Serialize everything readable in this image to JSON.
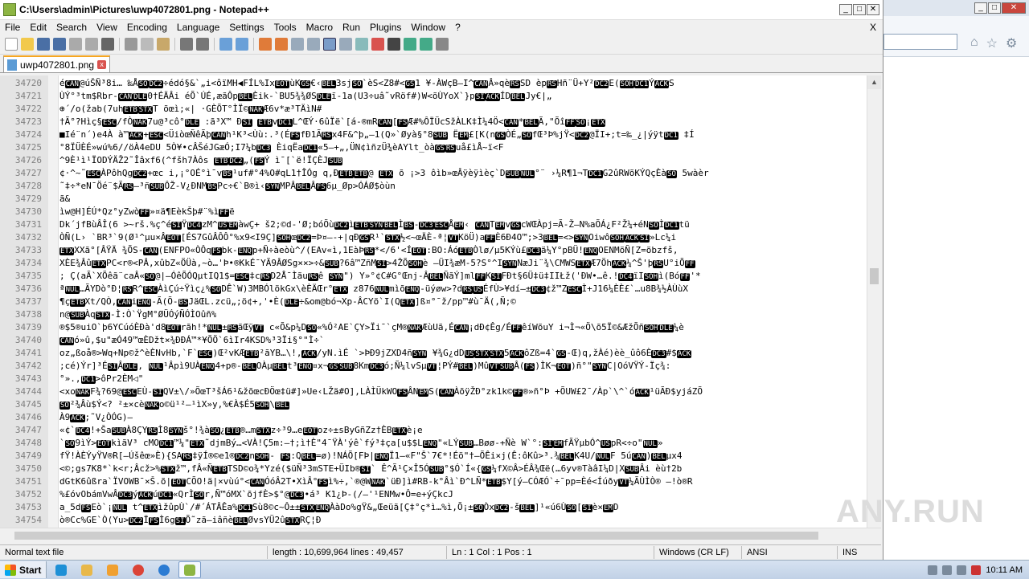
{
  "window": {
    "title": "C:\\Users\\admin\\Pictures\\uwp4072801.png - Notepad++",
    "menus": [
      "File",
      "Edit",
      "Search",
      "View",
      "Encoding",
      "Language",
      "Settings",
      "Tools",
      "Macro",
      "Run",
      "Plugins",
      "Window",
      "?"
    ],
    "close_x": "X"
  },
  "tab": {
    "label": "uwp4072801.png"
  },
  "editor": {
    "lines": [
      {
        "n": "34720",
        "t": "éCAN@úŠÑ³8i… ‰ÅSODC2÷édó§&`„i<ôïMH◀FÍL%IxEOTùKGS€‹BEL3sjSO`èS<Z8#<GS1 ¥-ÀWçB–I^CANÂ»qèRSSD èpRSHñ¨Ü+Y²DC2E(SOHDC1ÝACKS"
      },
      {
        "n": "34721",
        "t": "ÙÝ°³tm$Rbr-CANDLE0†ÉÄÂi      éÕ`ÚÉ,æãÔpBELÈik-`BU5¾¾ØSDLEï-1a(U3÷uâ˜vRöf#)W<õÙYoX`}pSIACKÍDBELJy€|„"
      },
      {
        "n": "34722",
        "t": "⊕´/o(žab(7uhETBSTXT õœì;«| ·GÈÕT°ÌÏ©NAKÆ6v*æ³TÄìN#"
      },
      {
        "n": "34723",
        "t": "†Ã°?Hìç§ESC/fÒNAK7u@³cô°DLE :ã³X™ ÐSI ETBvDC1L^ŒÝ·6ûÏë`[á-®mRCAN[FSÆ#%ÔÏÜcSžÀLK‡Ì¼4Ö<CAN*BELÃ,\"ÕîFFSO¡ETX"
      },
      {
        "n": "34724",
        "t": "■Ié¨n´)e4À à™ACK+ESC<ÜiòœÑêÃþCANh¹K³<Ùù:.³(ÉFSfÐ1ÃRSx4F&^þ„–1(Q»`Øyà§°8SUB ËEM£[K(nGSÒÉ„SOfŒ³Þ%jŸ<DC2@ÏI+;t=‰_¿|ýÿtDC1 ‡Í"
      },
      {
        "n": "34725",
        "t": "°8ÏÜÈÉ»wú%6//öÀ4eDU 5Ò¥•cÂŠéJGæÓ;I7¼bDC3 ÈiqËaDC1«5–+„,ÜN¢ìñzÜ¾èAYlt_òàGSRSuå£ìÅ~ï<F"
      },
      {
        "n": "34726",
        "t": "^9È¹ì¹ÏODÝÄŽ2˜Îâxf6(^fšh7Àôs ETBDC2„(FSÝ ì¯[`ë!ÏÇÈJSUB"
      },
      {
        "n": "34727",
        "t": "¢·^~˜ESCÀPôhQgDC2+œc i,¡°OÉ°ì¯vBS¹uf#°4%O#qL1†ÎÓg q,ÐETBETB@ ETX õ ¡>3 ôìb»œÂÿèÿìèç`DSUBNUL°¨ ›¼R¶1¬TDC1G2ûRWõKÝQçÈàSO 5wàèr"
      },
      {
        "n": "34728",
        "t": " ˜‡÷*eN¯Öé¨$ÃRS–³ñSUBÔŽ-V¿ÐNMBSPc÷€`B®ì‹SYNMPÂBELÂFS6µ_Øp>ÓÁØ$òùn"
      },
      {
        "n": "34729",
        "t": "ã&"
      },
      {
        "n": "34730",
        "t": "ìw@H]ÉÚ*Qz°yZwòFF»¤ä¶EèkŠþ#¨%ìFFë"
      },
      {
        "n": "34731",
        "t": "Dk´jfBùÂÎ(6 >~rš.%ç^éSIŸDC4zM^USEMàwÇ+ š2;©d-'Ø;bóÕùDC2ìETBSYNBELÌBS-DC3ESCÅEM‹ CANTEMvGScWŒÀpj=Ã-Ž–N%aÕÁ¿F²Ž¼+éNSOÌDC1tü"
      },
      {
        "n": "34732",
        "t": "ÒÑ(L› `BR³`9(Ø¹^µu×ÂEOT[ÉS7GûÂÔÔ°%x9<I9Ç]SOHœDC2=Þ¤—-+|qÐGSR¹`STX½<~œÄÈ-ª¦VTKöÜ)aFFÈ6Ð4O™;>3BEL=<>SYNOiwôSOHACKSI»Lc¼i"
      },
      {
        "n": "34733",
        "t": "ETXXXã°[ÂŸÄ ¾ÕS-CAN(ENFPO«ÒÔqFSbk-ENQp+Ñ÷àeòù^/(EAv«ì,1EàÞRS*</6'<ÍEOT:BO:ÁóETBÒlø/µ5KÝù£DC3ä¼Y°pBÜ!ENQOENMöÑ[Z=öbzfš,"
      },
      {
        "n": "34734",
        "t": "XÈE¾ÂûETXPC<r®<PÂ,xûbZ«ÖÜà,~ò…'Þ•®KkÉ¯YÃ9ÂØSg××>÷&SUB?6â™ZñMSI>4ŽÕSOHè –ÜI¾æM-5?S°^ISYNNæJi¨¾\\CMWSETXÆ7ÖhACK¼^Š'þRSU°iÕFF"
      },
      {
        "n": "34735",
        "t": ";    Ç(aÃ`XÕêã¨caÂ«SO@|—ÓêÕÓQµtIQ1$=ESC‡cRSD2Å¯ÌãuRSê SYN\") Y»°¢C#G°Œnj-ÂBELÑãÝ]mlFFKSIFÐt§6Ü‡ü‡IIŁž('ÐW•…ê.!DC4ïISOHì(BóFF'*"
      },
      {
        "n": "34736",
        "t": "ªNUL…ÃYDò°Ð¦RSR^ESCÀìÇú÷Ÿìç¿%SODÊ`W)3MBÓlökGx\\èÈÄŒr°ETX z876NULmìõENQ-üýøw>?dRSUSÉfÙ>¥dí–±DC3¢ž™ZESCÌ+J16¼ÈÈ£`…u8B¾½ÀÙùX"
      },
      {
        "n": "34737",
        "t": "¶çETBXt/QÒ,CANiENQ-Ã(Õ-BSJäŒL.zcü„;ö¢+,'•È(DLE÷&om@bó¬Xp-ÂCYö`I(QETX]ß¤°¯ž/pp™#ù¯Ä(,Ñ;©"
      },
      {
        "n": "34738",
        "t": "n@SUBÀqSTX-Ì:Ò`ŸgM°ØÜÓýÑÓÌOûñ%"
      },
      {
        "n": "34739",
        "t": "®$5®uiO`þ6YCúóÈÐà'd8EOTrãh!*NUL±RSãŒÿVT    c«Õ&p¼DSO«%Ó²AE`ÇY>Ïi¯`çM®NAKÆùUã,ÉCAN¡dÐ¢Êg/ÉFFêíWõuY i¬Ì¬«Ö\\õ5Ï©&ÆžÕñSOHDLE¼è"
      },
      {
        "n": "34740",
        "t": "CANó»û,$u\"æÓ49™œÈDžt×¾ÐÐÁ™*¥ÕÖ`6ìIr4KSD%³3Ïi§°\"Ì÷`"
      },
      {
        "n": "34741",
        "t": "oz„ßoå®>Wq+Np©ž^èÈNvHb,`F`ESC)Œ²vKÆETB²ãYB…\\!,ACK/yN.ìÉ `>ÞÐ9jZXD4ñSYN ¥¾G¿dDUSSTXSTX5ACKôZß=4`GS-Œ)q,žÀé)èè_ûô6ÈDC3#$ACK"
      },
      {
        "n": "34742",
        "t": ";cé)Ýr]³ÉSIÂDLE, NUL¹Âpì9UÀENQ4+p®-BELOÀµBELt³ENQ¤x¬GSSUB8KmDC3ó;Ñ¼lvSµVT¦PÝ#BEL)MûVTSUBÂ(FS)ÌK¬EOT)ñ°\"SYNC|OóVŸÝ-Ïç¾:"
      },
      {
        "n": "34743",
        "t": "°».,DC1>ôPr2ÈM◁\""
      },
      {
        "n": "34744",
        "t": "<xoNAKF¾?69@ESCEÙ-SIQV±\\/»ÕœT³šÁ6¹&žõœcÐÖœ‡ü#]»Ue‹LŽä#O],LÀÌÜkWOFSÂNEMS(CANÀõÿŽÐ°zk1k©FF®»ñ°Þ +ÕUW£2¯/Àp`\\^`óACK¹üÃÐ$yjáZÕ"
      },
      {
        "n": "34745",
        "t": "SO²¾Âù$Ý<? ²±×cèNAKo©ü¹²–¹ìX»y,%€À$É5SOH\\BEL"
      },
      {
        "n": "34746",
        "t": "À9ACK;˜V¿ÒÓG)–"
      },
      {
        "n": "34747",
        "t": "«¢`DC4!+ŠaSUBÀ8ÇYRSÌ8SYNš°!¾àSO¿ETB®…mSTXz÷³9…eEOToz÷±sByGñZz†ÈBETXè¡e"
      },
      {
        "n": "34748",
        "t": "`SO9ìÝ>EOTkìãV³     cMODC1™¼\"ETX˜djmBý…<VÀ!Ç5m:–†;ì†È\"4¯ŸÀ'ýê`fý³‡ça[u$$LENQ\"«LÝSUB…Bøø-+Ñè    W`°:SIEMfÃŸµbÓ^USpR<÷o\"NUL»"
      },
      {
        "n": "34749",
        "t": "fŸ!ÀÈÝyŸV®R[–Úšêœ»È){SARS‡ÿÍ®©e1®DC2nSOH-  FS:QBEL=ø)!NÁÕ[FÞ|ENQÏ1–«F\"Š`7€*!Éö\"†–ÕÊi×j(Ê:ôKû>³.¾BELK4U/NULF  5úCAN)BELµx4"
      },
      {
        "n": "34750",
        "t": "<©;gs7K8*`k<r;Âcž>%STXž™,fÂ«ÑETBTSD©o¾*Yzé($üÑ³3mSTE+ÜIb®SI` Ê^Ã¹Ç×Î5ÓSUB°$Ó`Í«{GS¼fX©Â>ÉÂ¾Œë(…6yv®TàâI¼D|XSUBÂi  èù†2b"
      },
      {
        "n": "34751",
        "t": "dGtK6ûßra`ÏVOWB¯×Š.õ|EOTCÕO!ä|×vùú°<CANÓóÂ2T•XìÂ°FSì%÷,`®@WNAK`üÐ]ì#RB-k°Âì`Ð^LÑ*ETB$Y[ý–CÓÆÓ`÷¯pp=Èé<ÍúðyVT¼ÃÙÌÒ®    –!ò®R"
      },
      {
        "n": "34752",
        "t": "%£óvObámVwÂDC3ýACKúDC1«QrÌSOr,Ñ™óMX`õjfÈ>$°@DC3•á³    K1¿Þ-(/–'¹ENMw•Ô=e+ýÇkcJ"
      },
      {
        "n": "34753",
        "t": "a_5dFSEò`¡NUL t^ETXìžûpÙ`/#´ÁTÂÊa%DC1Sù8©c~Ô±±STXENQÀàDo%gŸ&„Œeüã[Ç‡°ç*ì…%ì,Õ¡±SOÒxDC2-šBEL]¹«ú6ÙSO[SIè×EMD"
      },
      {
        "n": "34754",
        "t": "ò®Cc%GE`Ò(Yu>DC2ÏFSÌ6gSIÕ˜zã–iâñèBELØvsYÜ2ûSTXRÇ¦Ð"
      }
    ]
  },
  "statusbar": {
    "type": "Normal text file",
    "length": "length : 10,699,964   lines : 49,457",
    "position": "Ln : 1   Col : 1   Pos : 1",
    "eol": "Windows (CR LF)",
    "encoding": "ANSI",
    "mode": "INS"
  },
  "taskbar": {
    "start": "Start",
    "clock": "10:11 AM"
  },
  "watermark": "ANY.RUN",
  "colors": {
    "accent_tab": "#f5a623",
    "control_char_bg": "#000000"
  }
}
